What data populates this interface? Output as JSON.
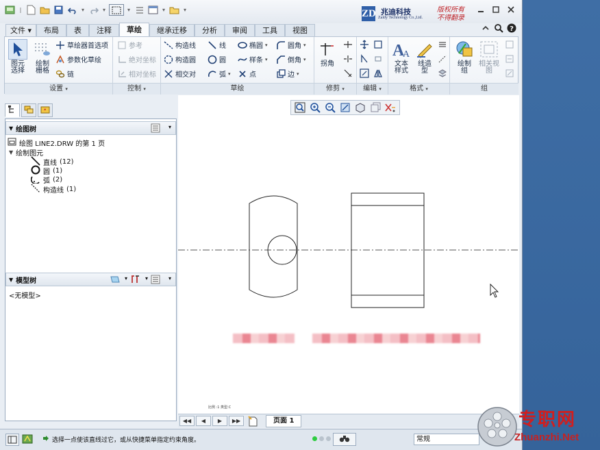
{
  "title_bar": {
    "logo_mark": "ZD",
    "company_cn": "兆迪科技",
    "company_en": "Zaldy Technology Co.,Ltd.",
    "rights_line1": "版权所有",
    "rights_line2": "不得翻录"
  },
  "tabs": [
    {
      "label": "文件"
    },
    {
      "label": "布局"
    },
    {
      "label": "表"
    },
    {
      "label": "注释"
    },
    {
      "label": "草绘"
    },
    {
      "label": "继承迁移"
    },
    {
      "label": "分析"
    },
    {
      "label": "审阅"
    },
    {
      "label": "工具"
    },
    {
      "label": "视图"
    }
  ],
  "active_tab": "草绘",
  "ribbon": {
    "settings": {
      "label": "设置",
      "select": "图元\n选择",
      "grid": "绘制\n栅格",
      "sketch_prefs": "草绘器首选项",
      "param_sketch": "参数化草绘",
      "chain": "链"
    },
    "control": {
      "label": "控制",
      "reference": "参考",
      "abs_coord": "绝对坐标",
      "rel_coord": "相对坐标"
    },
    "sketch": {
      "label": "草绘",
      "construction_line": "构造线",
      "construction_circle": "构造圆",
      "intersect": "相交对",
      "line": "线",
      "circle": "圆",
      "arc": "弧",
      "ellipse": "椭圆",
      "spline": "样条",
      "point": "点",
      "fillet": "圆角",
      "chamfer": "倒角",
      "edge": "边"
    },
    "modify": {
      "label": "修剪",
      "corner": "拐角"
    },
    "edit": {
      "label": "编辑"
    },
    "format": {
      "label": "格式",
      "text_style": "文本\n样式",
      "line_style": "线造\n型"
    },
    "group": {
      "label": "组",
      "draw_group": "绘制\n组",
      "related_view": "相关视\n图"
    }
  },
  "drawing_tree": {
    "header": "绘图树",
    "root": "绘图 LINE2.DRW 的第 1 页",
    "folder": "绘制图元",
    "items": [
      {
        "label": "直线",
        "count": "(12)"
      },
      {
        "label": "圆",
        "count": "(1)"
      },
      {
        "label": "弧",
        "count": "(2)"
      },
      {
        "label": "构造线",
        "count": "(1)"
      }
    ]
  },
  "model_tree": {
    "header": "模型树",
    "empty": "<无模型>"
  },
  "canvas": {
    "scale_text": "比例 :1  类型:C"
  },
  "page_bar": {
    "page_label": "页面 1"
  },
  "status": {
    "message": "选择一点使该直线过它，或从快捷菜单指定约束角度。",
    "filter": "常规"
  },
  "watermark": {
    "text": "专职网",
    "url": "Zhuanzhi.Net"
  },
  "colors": {
    "accent": "#2f5fa8",
    "watermark_red": "#d11e1e",
    "desktop": "#3b6aa0"
  }
}
